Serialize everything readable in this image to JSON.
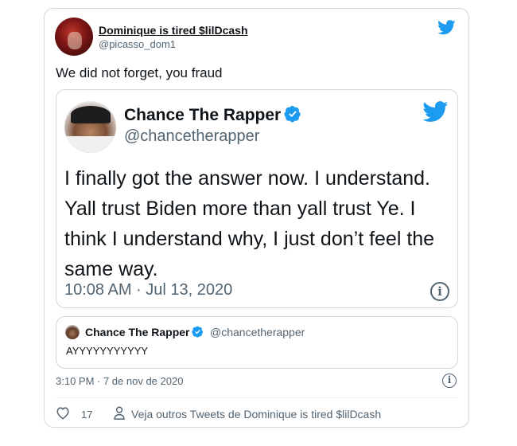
{
  "tweet": {
    "author_name": "Dominique is tired $lilDcash",
    "author_handle": "@picasso_dom1",
    "text": "We did not forget, you fraud",
    "timestamp": "3:10 PM · 7 de nov de 2020",
    "likes": "17",
    "see_more": "Veja outros Tweets de Dominique is tired $lilDcash"
  },
  "embedded": {
    "author_name": "Chance The Rapper",
    "author_handle": "@chancetherapper",
    "text": "I finally got the answer now. I understand. Yall trust Biden more than yall trust Ye. I think I understand why, I just don’t feel the same way.",
    "timestamp": "10:08 AM · Jul 13, 2020"
  },
  "quoted": {
    "author_name": "Chance The Rapper",
    "author_handle": "@chancetherapper",
    "text": "AYYYYYYYYYYY"
  },
  "icons": {
    "logo": "twitter-bird-icon",
    "verified": "verified-badge-icon",
    "info": "info-icon",
    "like": "heart-icon",
    "person": "person-icon"
  },
  "colors": {
    "brand": "#1d9bf0",
    "muted": "#536471",
    "border": "#cfd9de"
  }
}
